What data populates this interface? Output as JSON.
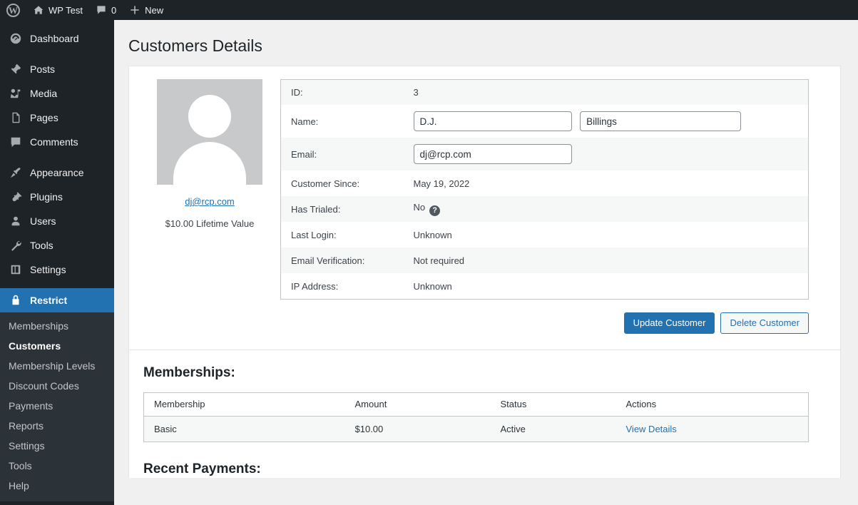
{
  "adminbar": {
    "wp_logo": "wordpress-logo",
    "site_name": "WP Test",
    "comments_count": "0",
    "new_label": "New"
  },
  "sidebar": {
    "items": [
      {
        "label": "Dashboard",
        "icon": "dashboard-icon",
        "current": false
      },
      {
        "label": "Posts",
        "icon": "pin-icon",
        "current": false
      },
      {
        "label": "Media",
        "icon": "media-icon",
        "current": false
      },
      {
        "label": "Pages",
        "icon": "pages-icon",
        "current": false
      },
      {
        "label": "Comments",
        "icon": "comments-icon",
        "current": false
      },
      {
        "label": "Appearance",
        "icon": "brush-icon",
        "current": false
      },
      {
        "label": "Plugins",
        "icon": "plug-icon",
        "current": false
      },
      {
        "label": "Users",
        "icon": "user-icon",
        "current": false
      },
      {
        "label": "Tools",
        "icon": "wrench-icon",
        "current": false
      },
      {
        "label": "Settings",
        "icon": "settings-icon",
        "current": false
      },
      {
        "label": "Restrict",
        "icon": "lock-icon",
        "current": true
      }
    ],
    "submenu": [
      {
        "label": "Memberships",
        "current": false
      },
      {
        "label": "Customers",
        "current": true
      },
      {
        "label": "Membership Levels",
        "current": false
      },
      {
        "label": "Discount Codes",
        "current": false
      },
      {
        "label": "Payments",
        "current": false
      },
      {
        "label": "Reports",
        "current": false
      },
      {
        "label": "Settings",
        "current": false
      },
      {
        "label": "Tools",
        "current": false
      },
      {
        "label": "Help",
        "current": false
      }
    ]
  },
  "page": {
    "title": "Customers Details"
  },
  "customer": {
    "avatar_email": "dj@rcp.com",
    "lifetime_value": "$10.00 Lifetime Value",
    "fields": {
      "id_label": "ID:",
      "id_value": "3",
      "name_label": "Name:",
      "first_name": "D.J.",
      "last_name": "Billings",
      "email_label": "Email:",
      "email_value": "dj@rcp.com",
      "since_label": "Customer Since:",
      "since_value": "May 19, 2022",
      "trialed_label": "Has Trialed:",
      "trialed_value": "No",
      "trialed_help": "?",
      "last_login_label": "Last Login:",
      "last_login_value": "Unknown",
      "verification_label": "Email Verification:",
      "verification_value": "Not required",
      "ip_label": "IP Address:",
      "ip_value": "Unknown"
    }
  },
  "actions": {
    "update_label": "Update Customer",
    "delete_label": "Delete Customer"
  },
  "memberships": {
    "heading": "Memberships:",
    "columns": {
      "membership": "Membership",
      "amount": "Amount",
      "status": "Status",
      "actions": "Actions"
    },
    "rows": [
      {
        "membership": "Basic",
        "amount": "$10.00",
        "status": "Active",
        "action_label": "View Details"
      }
    ]
  },
  "payments": {
    "heading": "Recent Payments:"
  },
  "colors": {
    "admin_bar": "#1d2327",
    "sidebar": "#1d2327",
    "submenu": "#2c3338",
    "accent": "#2271b1",
    "content_bg": "#f0f0f1",
    "row_alt": "#f6f7f7"
  }
}
